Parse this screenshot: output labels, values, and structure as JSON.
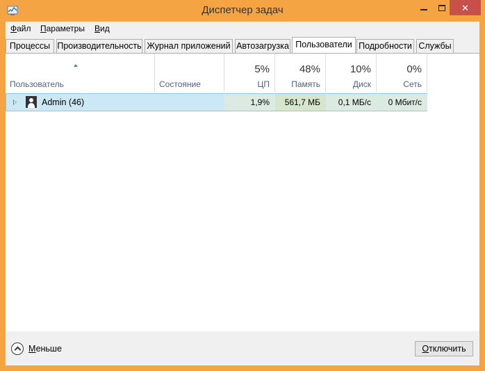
{
  "window": {
    "title": "Диспетчер задач",
    "close_glyph": "✕"
  },
  "menu": [
    {
      "label": "Файл",
      "underline": "Ф",
      "rest": "айл"
    },
    {
      "label": "Параметры",
      "underline": "П",
      "rest": "араметры"
    },
    {
      "label": "Вид",
      "underline": "В",
      "rest": "ид"
    }
  ],
  "tabs": [
    {
      "label": "Процессы"
    },
    {
      "label": "Производительность"
    },
    {
      "label": "Журнал приложений"
    },
    {
      "label": "Автозагрузка"
    },
    {
      "label": "Пользователи",
      "active": true
    },
    {
      "label": "Подробности"
    },
    {
      "label": "Службы"
    }
  ],
  "columns": {
    "user": {
      "label": "Пользователь"
    },
    "state": {
      "label": "Состояние"
    },
    "cpu": {
      "percent": "5%",
      "label": "ЦП"
    },
    "memory": {
      "percent": "48%",
      "label": "Память"
    },
    "disk": {
      "percent": "10%",
      "label": "Диск"
    },
    "network": {
      "percent": "0%",
      "label": "Сеть"
    }
  },
  "rows": [
    {
      "user": "Admin (46)",
      "state": "",
      "cpu": "1,9%",
      "memory": "561,7 МБ",
      "disk": "0,1 МБ/с",
      "network": "0 Мбит/с"
    }
  ],
  "footer": {
    "less_label": "Меньше",
    "less_underline": "М",
    "less_rest": "еньше",
    "end_button": "Отключить",
    "end_underline": "О",
    "end_rest": "тключить"
  },
  "colors": {
    "frame": "#f5a443",
    "close_button": "#c7504b",
    "selection": "#cce8f4"
  }
}
